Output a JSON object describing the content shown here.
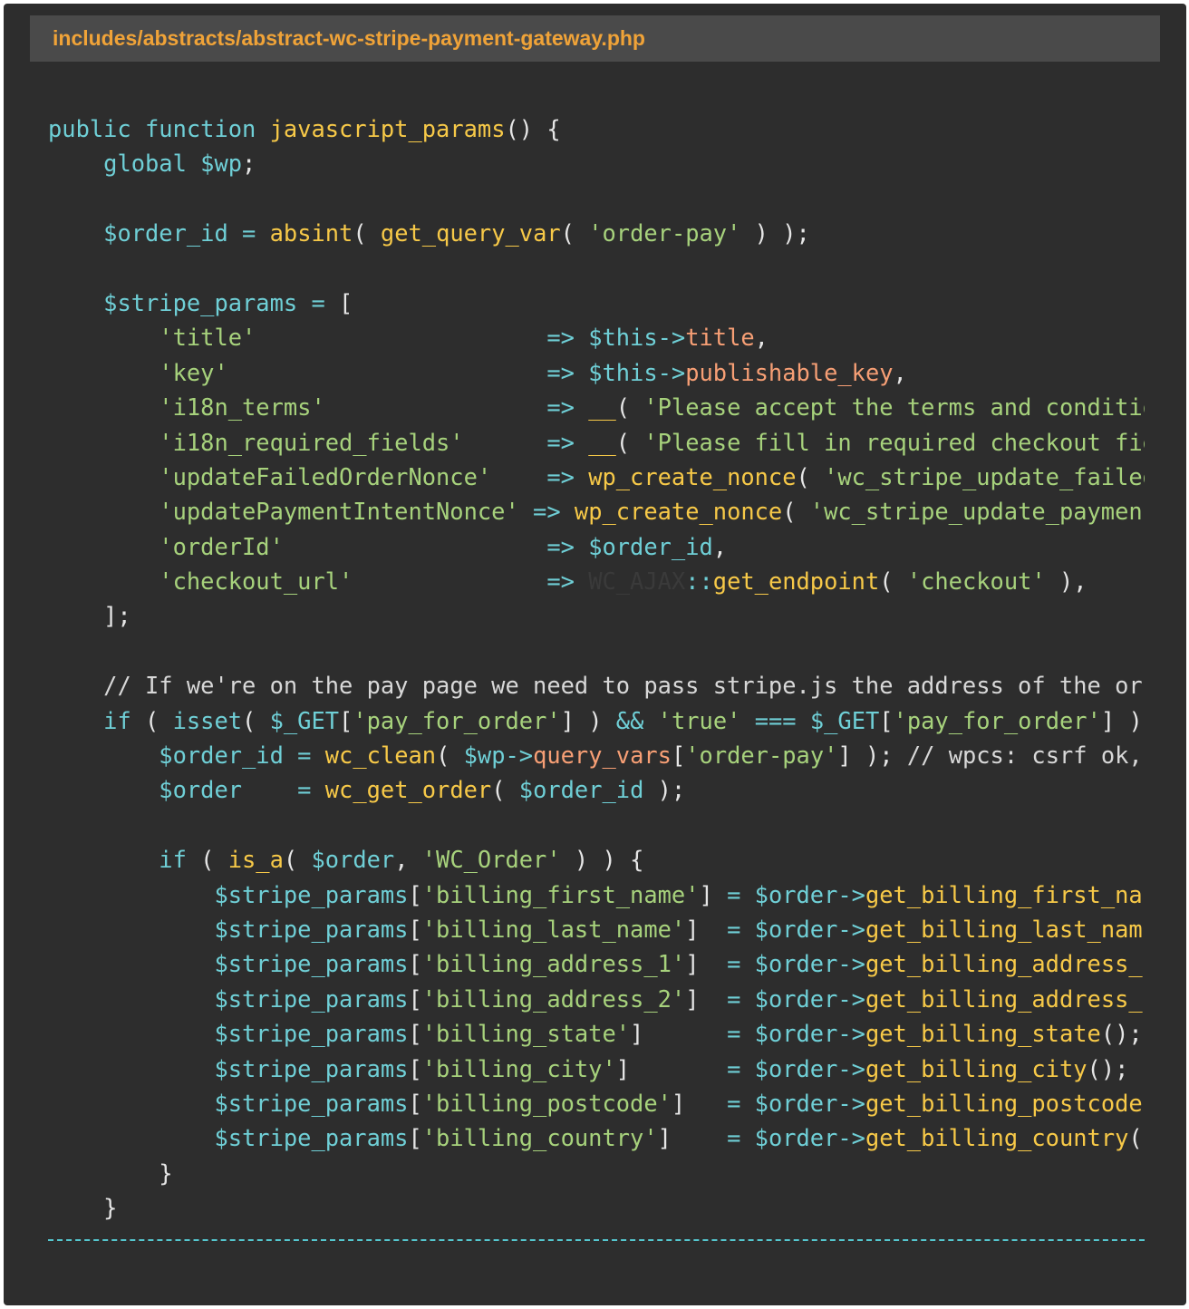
{
  "file_header": {
    "path": "includes/abstracts/abstract-wc-stripe-payment-gateway.php"
  },
  "code_lines": [
    [
      {
        "t": "public",
        "c": "kw"
      },
      {
        "t": " ",
        "c": "pl"
      },
      {
        "t": "function",
        "c": "kw"
      },
      {
        "t": " ",
        "c": "pl"
      },
      {
        "t": "javascript_params",
        "c": "fn"
      },
      {
        "t": "() {",
        "c": "pl"
      }
    ],
    [
      {
        "t": "    ",
        "c": "pl"
      },
      {
        "t": "global",
        "c": "kw"
      },
      {
        "t": " ",
        "c": "pl"
      },
      {
        "t": "$wp",
        "c": "var"
      },
      {
        "t": ";",
        "c": "pl"
      }
    ],
    [],
    [
      {
        "t": "    ",
        "c": "pl"
      },
      {
        "t": "$order_id",
        "c": "var"
      },
      {
        "t": " ",
        "c": "pl"
      },
      {
        "t": "=",
        "c": "op"
      },
      {
        "t": " ",
        "c": "pl"
      },
      {
        "t": "absint",
        "c": "fn"
      },
      {
        "t": "( ",
        "c": "pl"
      },
      {
        "t": "get_query_var",
        "c": "fn"
      },
      {
        "t": "( ",
        "c": "pl"
      },
      {
        "t": "'order-pay'",
        "c": "str"
      },
      {
        "t": " ) );",
        "c": "pl"
      }
    ],
    [],
    [
      {
        "t": "    ",
        "c": "pl"
      },
      {
        "t": "$stripe_params",
        "c": "var"
      },
      {
        "t": " ",
        "c": "pl"
      },
      {
        "t": "=",
        "c": "op"
      },
      {
        "t": " [",
        "c": "pl"
      }
    ],
    [
      {
        "t": "        ",
        "c": "pl"
      },
      {
        "t": "'title'",
        "c": "str"
      },
      {
        "t": "                     ",
        "c": "pl"
      },
      {
        "t": "=>",
        "c": "op"
      },
      {
        "t": " ",
        "c": "pl"
      },
      {
        "t": "$this",
        "c": "var"
      },
      {
        "t": "->",
        "c": "op"
      },
      {
        "t": "title",
        "c": "prop"
      },
      {
        "t": ",",
        "c": "pl"
      }
    ],
    [
      {
        "t": "        ",
        "c": "pl"
      },
      {
        "t": "'key'",
        "c": "str"
      },
      {
        "t": "                       ",
        "c": "pl"
      },
      {
        "t": "=>",
        "c": "op"
      },
      {
        "t": " ",
        "c": "pl"
      },
      {
        "t": "$this",
        "c": "var"
      },
      {
        "t": "->",
        "c": "op"
      },
      {
        "t": "publishable_key",
        "c": "prop"
      },
      {
        "t": ",",
        "c": "pl"
      }
    ],
    [
      {
        "t": "        ",
        "c": "pl"
      },
      {
        "t": "'i18n_terms'",
        "c": "str"
      },
      {
        "t": "                ",
        "c": "pl"
      },
      {
        "t": "=>",
        "c": "op"
      },
      {
        "t": " ",
        "c": "pl"
      },
      {
        "t": "__",
        "c": "fn"
      },
      {
        "t": "( ",
        "c": "pl"
      },
      {
        "t": "'Please accept the terms and conditio",
        "c": "str"
      }
    ],
    [
      {
        "t": "        ",
        "c": "pl"
      },
      {
        "t": "'i18n_required_fields'",
        "c": "str"
      },
      {
        "t": "      ",
        "c": "pl"
      },
      {
        "t": "=>",
        "c": "op"
      },
      {
        "t": " ",
        "c": "pl"
      },
      {
        "t": "__",
        "c": "fn"
      },
      {
        "t": "( ",
        "c": "pl"
      },
      {
        "t": "'Please fill in required checkout fie",
        "c": "str"
      }
    ],
    [
      {
        "t": "        ",
        "c": "pl"
      },
      {
        "t": "'updateFailedOrderNonce'",
        "c": "str"
      },
      {
        "t": "    ",
        "c": "pl"
      },
      {
        "t": "=>",
        "c": "op"
      },
      {
        "t": " ",
        "c": "pl"
      },
      {
        "t": "wp_create_nonce",
        "c": "fn"
      },
      {
        "t": "( ",
        "c": "pl"
      },
      {
        "t": "'wc_stripe_update_failed",
        "c": "str"
      }
    ],
    [
      {
        "t": "        ",
        "c": "pl"
      },
      {
        "t": "'updatePaymentIntentNonce'",
        "c": "str"
      },
      {
        "t": " ",
        "c": "pl"
      },
      {
        "t": "=>",
        "c": "op"
      },
      {
        "t": " ",
        "c": "pl"
      },
      {
        "t": "wp_create_nonce",
        "c": "fn"
      },
      {
        "t": "( ",
        "c": "pl"
      },
      {
        "t": "'wc_stripe_update_paymen",
        "c": "str"
      }
    ],
    [
      {
        "t": "        ",
        "c": "pl"
      },
      {
        "t": "'orderId'",
        "c": "str"
      },
      {
        "t": "                   ",
        "c": "pl"
      },
      {
        "t": "=>",
        "c": "op"
      },
      {
        "t": " ",
        "c": "pl"
      },
      {
        "t": "$order_id",
        "c": "var"
      },
      {
        "t": ",",
        "c": "pl"
      }
    ],
    [
      {
        "t": "        ",
        "c": "pl"
      },
      {
        "t": "'checkout_url'",
        "c": "str"
      },
      {
        "t": "              ",
        "c": "pl"
      },
      {
        "t": "=>",
        "c": "op"
      },
      {
        "t": " ",
        "c": "pl"
      },
      {
        "t": "WC_AJAX",
        "c": "dim"
      },
      {
        "t": "::",
        "c": "op"
      },
      {
        "t": "get_endpoint",
        "c": "fn"
      },
      {
        "t": "( ",
        "c": "pl"
      },
      {
        "t": "'checkout'",
        "c": "str"
      },
      {
        "t": " ),",
        "c": "pl"
      }
    ],
    [
      {
        "t": "    ];",
        "c": "pl"
      }
    ],
    [],
    [
      {
        "t": "    ",
        "c": "pl"
      },
      {
        "t": "// If we're on the pay page we need to pass stripe.js the address of the or",
        "c": "cm"
      }
    ],
    [
      {
        "t": "    ",
        "c": "pl"
      },
      {
        "t": "if",
        "c": "kw"
      },
      {
        "t": " ( ",
        "c": "pl"
      },
      {
        "t": "isset",
        "c": "kw"
      },
      {
        "t": "( ",
        "c": "pl"
      },
      {
        "t": "$_GET",
        "c": "var"
      },
      {
        "t": "[",
        "c": "pl"
      },
      {
        "t": "'pay_for_order'",
        "c": "str"
      },
      {
        "t": "] ) ",
        "c": "pl"
      },
      {
        "t": "&&",
        "c": "op"
      },
      {
        "t": " ",
        "c": "pl"
      },
      {
        "t": "'true'",
        "c": "str"
      },
      {
        "t": " ",
        "c": "pl"
      },
      {
        "t": "===",
        "c": "op"
      },
      {
        "t": " ",
        "c": "pl"
      },
      {
        "t": "$_GET",
        "c": "var"
      },
      {
        "t": "[",
        "c": "pl"
      },
      {
        "t": "'pay_for_order'",
        "c": "str"
      },
      {
        "t": "] )",
        "c": "pl"
      }
    ],
    [
      {
        "t": "        ",
        "c": "pl"
      },
      {
        "t": "$order_id",
        "c": "var"
      },
      {
        "t": " ",
        "c": "pl"
      },
      {
        "t": "=",
        "c": "op"
      },
      {
        "t": " ",
        "c": "pl"
      },
      {
        "t": "wc_clean",
        "c": "fn"
      },
      {
        "t": "( ",
        "c": "pl"
      },
      {
        "t": "$wp",
        "c": "var"
      },
      {
        "t": "->",
        "c": "op"
      },
      {
        "t": "query_vars",
        "c": "prop"
      },
      {
        "t": "[",
        "c": "pl"
      },
      {
        "t": "'order-pay'",
        "c": "str"
      },
      {
        "t": "] ); ",
        "c": "pl"
      },
      {
        "t": "// wpcs: csrf ok,",
        "c": "cm"
      }
    ],
    [
      {
        "t": "        ",
        "c": "pl"
      },
      {
        "t": "$order",
        "c": "var"
      },
      {
        "t": "    ",
        "c": "pl"
      },
      {
        "t": "=",
        "c": "op"
      },
      {
        "t": " ",
        "c": "pl"
      },
      {
        "t": "wc_get_order",
        "c": "fn"
      },
      {
        "t": "( ",
        "c": "pl"
      },
      {
        "t": "$order_id",
        "c": "var"
      },
      {
        "t": " );",
        "c": "pl"
      }
    ],
    [],
    [
      {
        "t": "        ",
        "c": "pl"
      },
      {
        "t": "if",
        "c": "kw"
      },
      {
        "t": " ( ",
        "c": "pl"
      },
      {
        "t": "is_a",
        "c": "fn"
      },
      {
        "t": "( ",
        "c": "pl"
      },
      {
        "t": "$order",
        "c": "var"
      },
      {
        "t": ", ",
        "c": "pl"
      },
      {
        "t": "'WC_Order'",
        "c": "str"
      },
      {
        "t": " ) ) {",
        "c": "pl"
      }
    ],
    [
      {
        "t": "            ",
        "c": "pl"
      },
      {
        "t": "$stripe_params",
        "c": "var"
      },
      {
        "t": "[",
        "c": "pl"
      },
      {
        "t": "'billing_first_name'",
        "c": "str"
      },
      {
        "t": "] ",
        "c": "pl"
      },
      {
        "t": "=",
        "c": "op"
      },
      {
        "t": " ",
        "c": "pl"
      },
      {
        "t": "$order",
        "c": "var"
      },
      {
        "t": "->",
        "c": "op"
      },
      {
        "t": "get_billing_first_na",
        "c": "fn"
      }
    ],
    [
      {
        "t": "            ",
        "c": "pl"
      },
      {
        "t": "$stripe_params",
        "c": "var"
      },
      {
        "t": "[",
        "c": "pl"
      },
      {
        "t": "'billing_last_name'",
        "c": "str"
      },
      {
        "t": "]  ",
        "c": "pl"
      },
      {
        "t": "=",
        "c": "op"
      },
      {
        "t": " ",
        "c": "pl"
      },
      {
        "t": "$order",
        "c": "var"
      },
      {
        "t": "->",
        "c": "op"
      },
      {
        "t": "get_billing_last_nam",
        "c": "fn"
      }
    ],
    [
      {
        "t": "            ",
        "c": "pl"
      },
      {
        "t": "$stripe_params",
        "c": "var"
      },
      {
        "t": "[",
        "c": "pl"
      },
      {
        "t": "'billing_address_1'",
        "c": "str"
      },
      {
        "t": "]  ",
        "c": "pl"
      },
      {
        "t": "=",
        "c": "op"
      },
      {
        "t": " ",
        "c": "pl"
      },
      {
        "t": "$order",
        "c": "var"
      },
      {
        "t": "->",
        "c": "op"
      },
      {
        "t": "get_billing_address_",
        "c": "fn"
      }
    ],
    [
      {
        "t": "            ",
        "c": "pl"
      },
      {
        "t": "$stripe_params",
        "c": "var"
      },
      {
        "t": "[",
        "c": "pl"
      },
      {
        "t": "'billing_address_2'",
        "c": "str"
      },
      {
        "t": "]  ",
        "c": "pl"
      },
      {
        "t": "=",
        "c": "op"
      },
      {
        "t": " ",
        "c": "pl"
      },
      {
        "t": "$order",
        "c": "var"
      },
      {
        "t": "->",
        "c": "op"
      },
      {
        "t": "get_billing_address_",
        "c": "fn"
      }
    ],
    [
      {
        "t": "            ",
        "c": "pl"
      },
      {
        "t": "$stripe_params",
        "c": "var"
      },
      {
        "t": "[",
        "c": "pl"
      },
      {
        "t": "'billing_state'",
        "c": "str"
      },
      {
        "t": "]      ",
        "c": "pl"
      },
      {
        "t": "=",
        "c": "op"
      },
      {
        "t": " ",
        "c": "pl"
      },
      {
        "t": "$order",
        "c": "var"
      },
      {
        "t": "->",
        "c": "op"
      },
      {
        "t": "get_billing_state",
        "c": "fn"
      },
      {
        "t": "();",
        "c": "pl"
      }
    ],
    [
      {
        "t": "            ",
        "c": "pl"
      },
      {
        "t": "$stripe_params",
        "c": "var"
      },
      {
        "t": "[",
        "c": "pl"
      },
      {
        "t": "'billing_city'",
        "c": "str"
      },
      {
        "t": "]       ",
        "c": "pl"
      },
      {
        "t": "=",
        "c": "op"
      },
      {
        "t": " ",
        "c": "pl"
      },
      {
        "t": "$order",
        "c": "var"
      },
      {
        "t": "->",
        "c": "op"
      },
      {
        "t": "get_billing_city",
        "c": "fn"
      },
      {
        "t": "();",
        "c": "pl"
      }
    ],
    [
      {
        "t": "            ",
        "c": "pl"
      },
      {
        "t": "$stripe_params",
        "c": "var"
      },
      {
        "t": "[",
        "c": "pl"
      },
      {
        "t": "'billing_postcode'",
        "c": "str"
      },
      {
        "t": "]   ",
        "c": "pl"
      },
      {
        "t": "=",
        "c": "op"
      },
      {
        "t": " ",
        "c": "pl"
      },
      {
        "t": "$order",
        "c": "var"
      },
      {
        "t": "->",
        "c": "op"
      },
      {
        "t": "get_billing_postcode",
        "c": "fn"
      }
    ],
    [
      {
        "t": "            ",
        "c": "pl"
      },
      {
        "t": "$stripe_params",
        "c": "var"
      },
      {
        "t": "[",
        "c": "pl"
      },
      {
        "t": "'billing_country'",
        "c": "str"
      },
      {
        "t": "]    ",
        "c": "pl"
      },
      {
        "t": "=",
        "c": "op"
      },
      {
        "t": " ",
        "c": "pl"
      },
      {
        "t": "$order",
        "c": "var"
      },
      {
        "t": "->",
        "c": "op"
      },
      {
        "t": "get_billing_country",
        "c": "fn"
      },
      {
        "t": "(",
        "c": "pl"
      }
    ],
    [
      {
        "t": "        }",
        "c": "pl"
      }
    ],
    [
      {
        "t": "    }",
        "c": "pl"
      }
    ]
  ]
}
